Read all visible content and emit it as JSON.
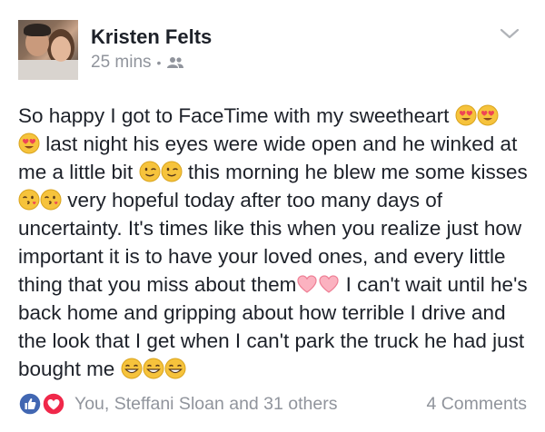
{
  "post": {
    "author": "Kristen Felts",
    "timestamp": "25 mins",
    "separator": "•",
    "privacy_icon": "friends-icon",
    "menu_icon": "chevron-down-icon",
    "text": {
      "line1a": "So happy I got to FaceTime with my sweetheart ",
      "line2a": " last night his eyes were wide open and he winked at me a little bit ",
      "line3a": " this morning he blew me some kisses ",
      "line4a": " very hopeful today after too many days of uncertainty. It's times like this when you realize just how important it is to have your loved ones, and every little thing that you miss about them",
      "line5a": " I can't wait until he's back home and gripping about how terrible I drive and the look that I get when I can't park the truck he had just bought me "
    },
    "emojis": {
      "heart_eyes": "smiling-face-with-heart-eyes",
      "wink": "winking-face",
      "kiss": "face-blowing-a-kiss",
      "heart": "pink-heart",
      "grin": "grinning-face"
    },
    "reactions": {
      "icons": [
        "like-icon",
        "love-icon"
      ],
      "names": "You, Steffani Sloan and 31 others",
      "comments": "4 Comments"
    }
  },
  "colors": {
    "like_blue": "#4267b2",
    "love_red": "#f0284a",
    "meta_gray": "#90949c",
    "text": "#1d2129"
  }
}
